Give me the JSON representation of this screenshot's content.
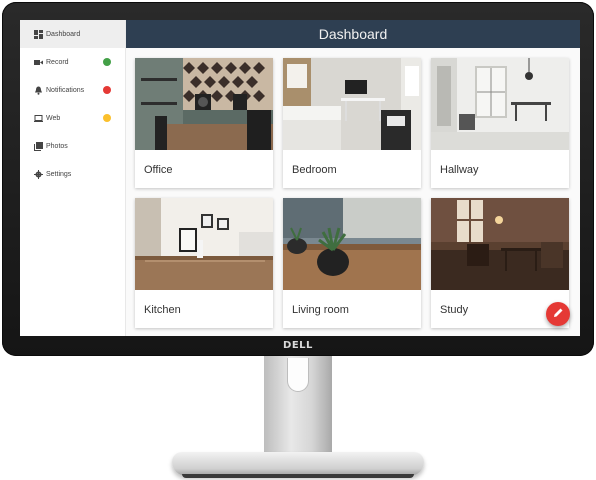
{
  "brand": {
    "logo_text": "DELL"
  },
  "topbar": {
    "title": "Dashboard"
  },
  "sidebar": {
    "items": [
      {
        "label": "Dashboard",
        "icon": "dashboard-icon",
        "active": true
      },
      {
        "label": "Record",
        "icon": "video-camera-icon",
        "status_color": "#43a047"
      },
      {
        "label": "Notifications",
        "icon": "bell-icon",
        "status_color": "#e53935"
      },
      {
        "label": "Web",
        "icon": "laptop-icon",
        "status_color": "#fbc02d"
      },
      {
        "label": "Photos",
        "icon": "photos-icon"
      },
      {
        "label": "Settings",
        "icon": "gear-icon"
      }
    ]
  },
  "rooms": [
    {
      "name": "Office"
    },
    {
      "name": "Bedroom"
    },
    {
      "name": "Hallway"
    },
    {
      "name": "Kitchen"
    },
    {
      "name": "Living room"
    },
    {
      "name": "Study"
    }
  ],
  "fab": {
    "icon": "pencil-icon",
    "color": "#e53935"
  }
}
